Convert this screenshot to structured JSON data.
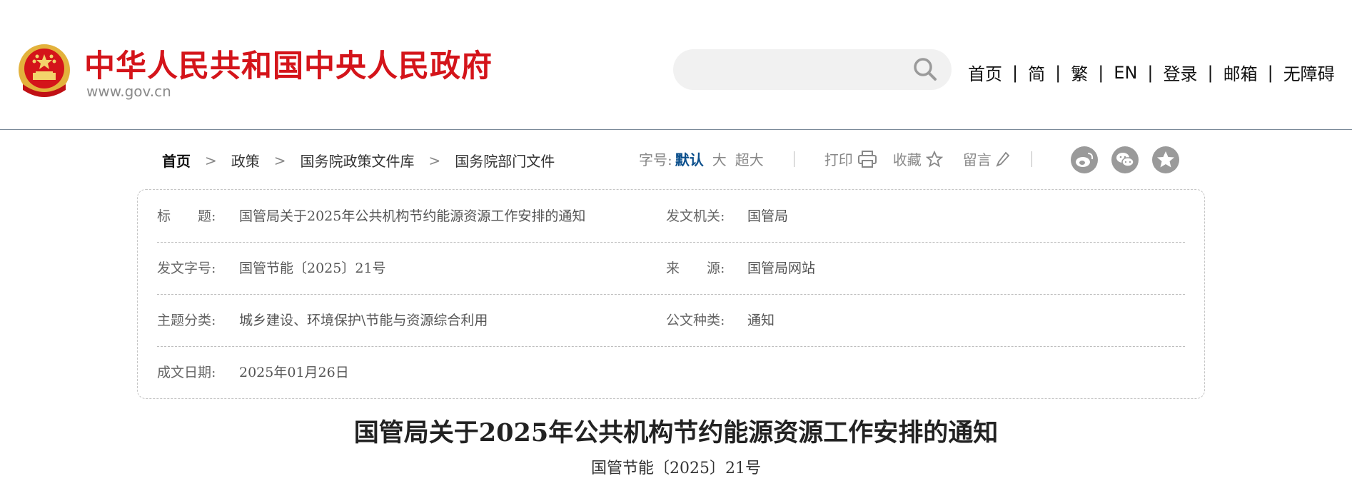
{
  "header": {
    "site_title": "中华人民共和国中央人民政府",
    "site_url": "www.gov.cn",
    "search": {
      "placeholder": "",
      "value": ""
    },
    "nav": [
      "首页",
      "简",
      "繁",
      "EN",
      "登录",
      "邮箱",
      "无障碍"
    ],
    "nav_separator": "|"
  },
  "breadcrumb": [
    "首页",
    "政策",
    "国务院政策文件库",
    "国务院部门文件"
  ],
  "breadcrumb_separator": ">",
  "tools": {
    "font_size_label": "字号:",
    "font_sizes": [
      "默认",
      "大",
      "超大"
    ],
    "print_label": "打印",
    "favorite_label": "收藏",
    "comment_label": "留言"
  },
  "share_icons": [
    "weibo-icon",
    "wechat-icon",
    "qzone-icon"
  ],
  "doc_info": {
    "title_label": "标　　题:",
    "title_value": "国管局关于2025年公共机构节约能源资源工作安排的通知",
    "issuer_label": "发文机关:",
    "issuer_value": "国管局",
    "doc_no_label": "发文字号:",
    "doc_no_value": "国管节能〔2025〕21号",
    "source_label": "来　　源:",
    "source_value": "国管局网站",
    "topic_label": "主题分类:",
    "topic_value": "城乡建设、环境保护\\节能与资源综合利用",
    "type_label": "公文种类:",
    "type_value": "通知",
    "date_label": "成文日期:",
    "date_value": "2025年01月26日"
  },
  "article": {
    "title": "国管局关于2025年公共机构节约能源资源工作安排的通知",
    "doc_no": "国管节能〔2025〕21号"
  },
  "colors": {
    "brand_red": "#d4141a",
    "active_blue": "#0b4f8c",
    "emblem_gold": "#e3b23c"
  }
}
